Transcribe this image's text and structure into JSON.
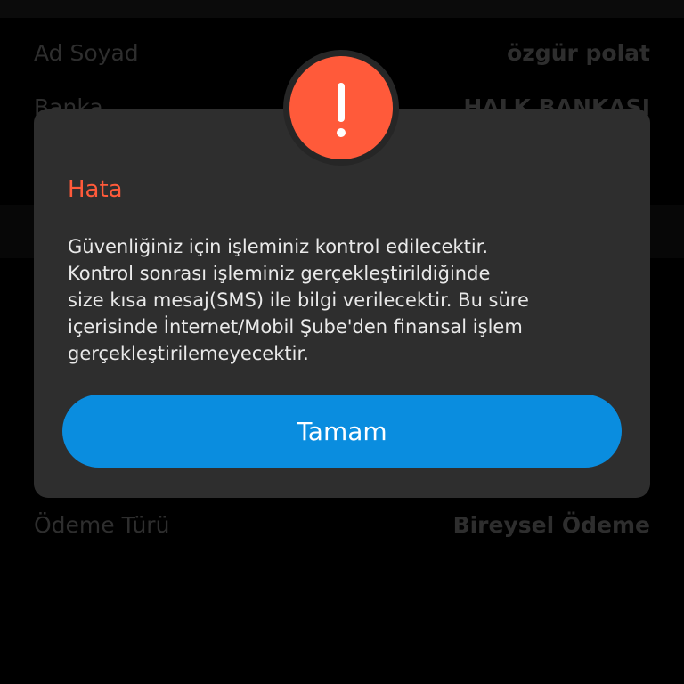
{
  "background": {
    "rows": [
      {
        "label": "Ad Soyad",
        "value": "özgür polat"
      },
      {
        "label": "Banka",
        "value": "HALK BANKASI"
      },
      {
        "label": "Ödeme Türü",
        "value": "Bireysel Ödeme"
      }
    ]
  },
  "dialog": {
    "icon": "exclamation-icon",
    "title": "Hata",
    "message_lines": [
      "Güvenliğiniz için işleminiz kontrol edilecektir.",
      "Kontrol sonrası işleminiz gerçekleştirildiğinde",
      "size kısa mesaj(SMS) ile bilgi verilecektir. Bu süre",
      "içerisinde İnternet/Mobil Şube'den finansal işlem",
      "gerçekleştirilemeyecektir."
    ],
    "button_label": "Tamam"
  },
  "colors": {
    "accent": "#ff5a3a",
    "button": "#0a8ddf",
    "dialog_bg": "#2e2e2e",
    "page_bg": "#000000"
  }
}
